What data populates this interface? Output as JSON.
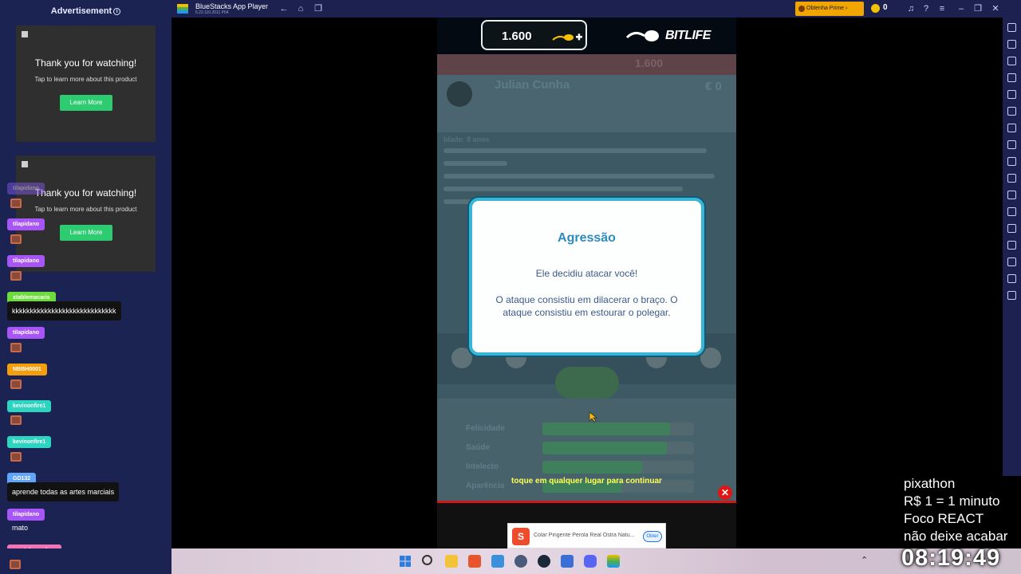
{
  "sidebar": {
    "ad_title": "Advertisement",
    "ads": [
      {
        "thanks": "Thank you for watching!",
        "sub": "Tap to learn more about this product",
        "button": "Learn More"
      },
      {
        "thanks": "Thank you for watching!",
        "sub": "Tap to learn more about this product",
        "button": "Learn More"
      }
    ],
    "chat": [
      {
        "user": "tilapidano",
        "color": "#8b5cf6",
        "message": ""
      },
      {
        "user": "tilapidano",
        "color": "#a855f7",
        "message": ""
      },
      {
        "user": "tilapidano",
        "color": "#a855f7",
        "message": ""
      },
      {
        "user": "xtablemacaris",
        "color": "#6bdc3a",
        "message": "kkkkkkkkkkkkkkkkkkkkkkkkkkkkk"
      },
      {
        "user": "tilapidano",
        "color": "#a855f7",
        "message": ""
      },
      {
        "user": "NBBH0001",
        "color": "#f59e0b",
        "message": ""
      },
      {
        "user": "kevinonfire1",
        "color": "#2dd4bf",
        "message": ""
      },
      {
        "user": "kevinonfire1",
        "color": "#2dd4bf",
        "message": ""
      },
      {
        "user": "GD132",
        "color": "#60a5fa",
        "message": "aprende todas as artes marciais"
      },
      {
        "user": "tilapidano",
        "color": "#a855f7",
        "message": "mato"
      },
      {
        "user": "crystal_pendors",
        "color": "#f472b6",
        "message": ""
      }
    ]
  },
  "bluestacks": {
    "title": "BlueStacks App Player",
    "version": "5.22.110.2011 P64",
    "prime_label": "Obtenha Prime",
    "coins": "0"
  },
  "game": {
    "money": "1.600",
    "logo": "BITLIFE",
    "dim_money": "1.600",
    "dim_name": "Julian Cunha",
    "dim_balance": "€ 0",
    "dim_age": "Idade: 8 anos",
    "stats": [
      "Felicidade",
      "Saúde",
      "Intelecto",
      "Aparência"
    ],
    "stat_fill": [
      0.84,
      0.82,
      0.66,
      0.52
    ],
    "dialog": {
      "title": "Agressão",
      "line1": "Ele decidiu atacar você!",
      "line2": "O ataque consistiu em dilacerar o braço. O ataque consistiu em estourar o polegar."
    },
    "tap_continue": "toque em qualquer lugar para continuar"
  },
  "product_ad": {
    "text": "Colar Pingente Perola Real Ostra Natu...",
    "button": "Obter"
  },
  "overlay": {
    "lines": [
      "pixathon",
      "R$ 1 = 1 minuto",
      "Foco REACT",
      "não deixe acabar"
    ],
    "clock": "08:19:49"
  },
  "colors": {
    "dialog_border": "#3ab5d8",
    "dialog_title": "#2e8bc0",
    "close": "#e01515",
    "prime": "#f0a500"
  }
}
